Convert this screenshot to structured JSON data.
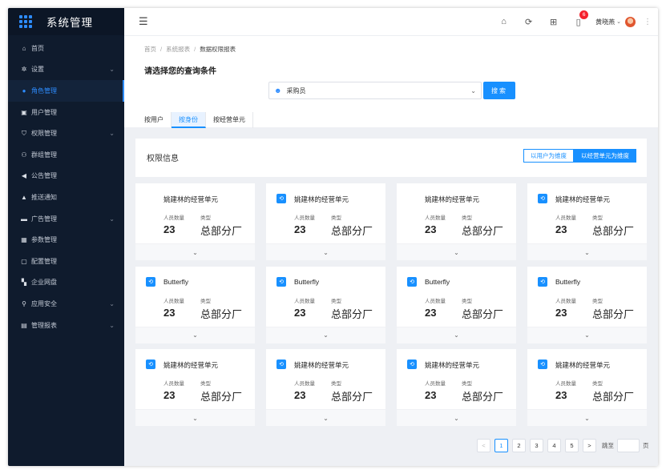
{
  "app": {
    "title": "系统管理"
  },
  "sidebar": {
    "items": [
      {
        "label": "首页",
        "icon": "home-icon",
        "glyph": "⌂",
        "chevron": ""
      },
      {
        "label": "设置",
        "icon": "gear-icon",
        "glyph": "✲",
        "chevron": "⌄"
      },
      {
        "label": "角色管理",
        "icon": "role-icon",
        "glyph": "●",
        "chevron": ""
      },
      {
        "label": "用户管理",
        "icon": "user-card-icon",
        "glyph": "▣",
        "chevron": ""
      },
      {
        "label": "权限管理",
        "icon": "shield-icon",
        "glyph": "⛉",
        "chevron": "⌄"
      },
      {
        "label": "群组管理",
        "icon": "group-icon",
        "glyph": "⚇",
        "chevron": ""
      },
      {
        "label": "公告管理",
        "icon": "megaphone-icon",
        "glyph": "◀",
        "chevron": ""
      },
      {
        "label": "推送通知",
        "icon": "bell-icon",
        "glyph": "▲",
        "chevron": ""
      },
      {
        "label": "广告管理",
        "icon": "ad-icon",
        "glyph": "▬",
        "chevron": "⌄"
      },
      {
        "label": "参数管理",
        "icon": "params-icon",
        "glyph": "▦",
        "chevron": ""
      },
      {
        "label": "配置管理",
        "icon": "config-icon",
        "glyph": "▢",
        "chevron": ""
      },
      {
        "label": "企业网盘",
        "icon": "disk-icon",
        "glyph": "▚",
        "chevron": ""
      },
      {
        "label": "应用安全",
        "icon": "security-icon",
        "glyph": "⚲",
        "chevron": "⌄"
      },
      {
        "label": "管理报表",
        "icon": "report-icon",
        "glyph": "▤",
        "chevron": "⌄"
      }
    ],
    "active_index": 2
  },
  "header": {
    "notification_count": "6",
    "user_name": "黄晓燕"
  },
  "breadcrumb": {
    "items": [
      "首页",
      "系统报表",
      "数据权限报表"
    ],
    "separator": "/"
  },
  "query": {
    "title": "请选择您的查询条件",
    "role_value": "采购员",
    "search_label": "搜索"
  },
  "tabs": [
    {
      "label": "按用户",
      "active": false
    },
    {
      "label": "按身份",
      "active": true
    },
    {
      "label": "按经营单元",
      "active": false
    }
  ],
  "permission": {
    "title": "权限信息",
    "toggle": [
      {
        "label": "以用户为维度",
        "on": false
      },
      {
        "label": "以经营单元为维度",
        "on": true
      }
    ]
  },
  "card_labels": {
    "count_label": "人员数量",
    "type_label": "类型"
  },
  "cards": [
    {
      "name": "姚建林的经营单元",
      "icon": false,
      "count": "23",
      "type": "总部分厂"
    },
    {
      "name": "姚建林的经营单元",
      "icon": true,
      "count": "23",
      "type": "总部分厂"
    },
    {
      "name": "姚建林的经营单元",
      "icon": false,
      "count": "23",
      "type": "总部分厂"
    },
    {
      "name": "姚建林的经营单元",
      "icon": true,
      "count": "23",
      "type": "总部分厂"
    },
    {
      "name": "Butterfly",
      "icon": true,
      "count": "23",
      "type": "总部分厂"
    },
    {
      "name": "Butterfly",
      "icon": true,
      "count": "23",
      "type": "总部分厂"
    },
    {
      "name": "Butterfly",
      "icon": true,
      "count": "23",
      "type": "总部分厂"
    },
    {
      "name": "Butterfly",
      "icon": true,
      "count": "23",
      "type": "总部分厂"
    },
    {
      "name": "姚建林的经营单元",
      "icon": true,
      "count": "23",
      "type": "总部分厂"
    },
    {
      "name": "姚建林的经营单元",
      "icon": true,
      "count": "23",
      "type": "总部分厂"
    },
    {
      "name": "姚建林的经营单元",
      "icon": true,
      "count": "23",
      "type": "总部分厂"
    },
    {
      "name": "姚建林的经营单元",
      "icon": true,
      "count": "23",
      "type": "总部分厂"
    }
  ],
  "pagination": {
    "prev": "<",
    "pages": [
      "1",
      "2",
      "3",
      "4",
      "5"
    ],
    "current": "1",
    "next": ">",
    "jump_label": "跳至",
    "unit": "页"
  },
  "colors": {
    "accent": "#1890ff",
    "sidebar_bg": "#0f1b2d",
    "badge": "#f5222d"
  }
}
